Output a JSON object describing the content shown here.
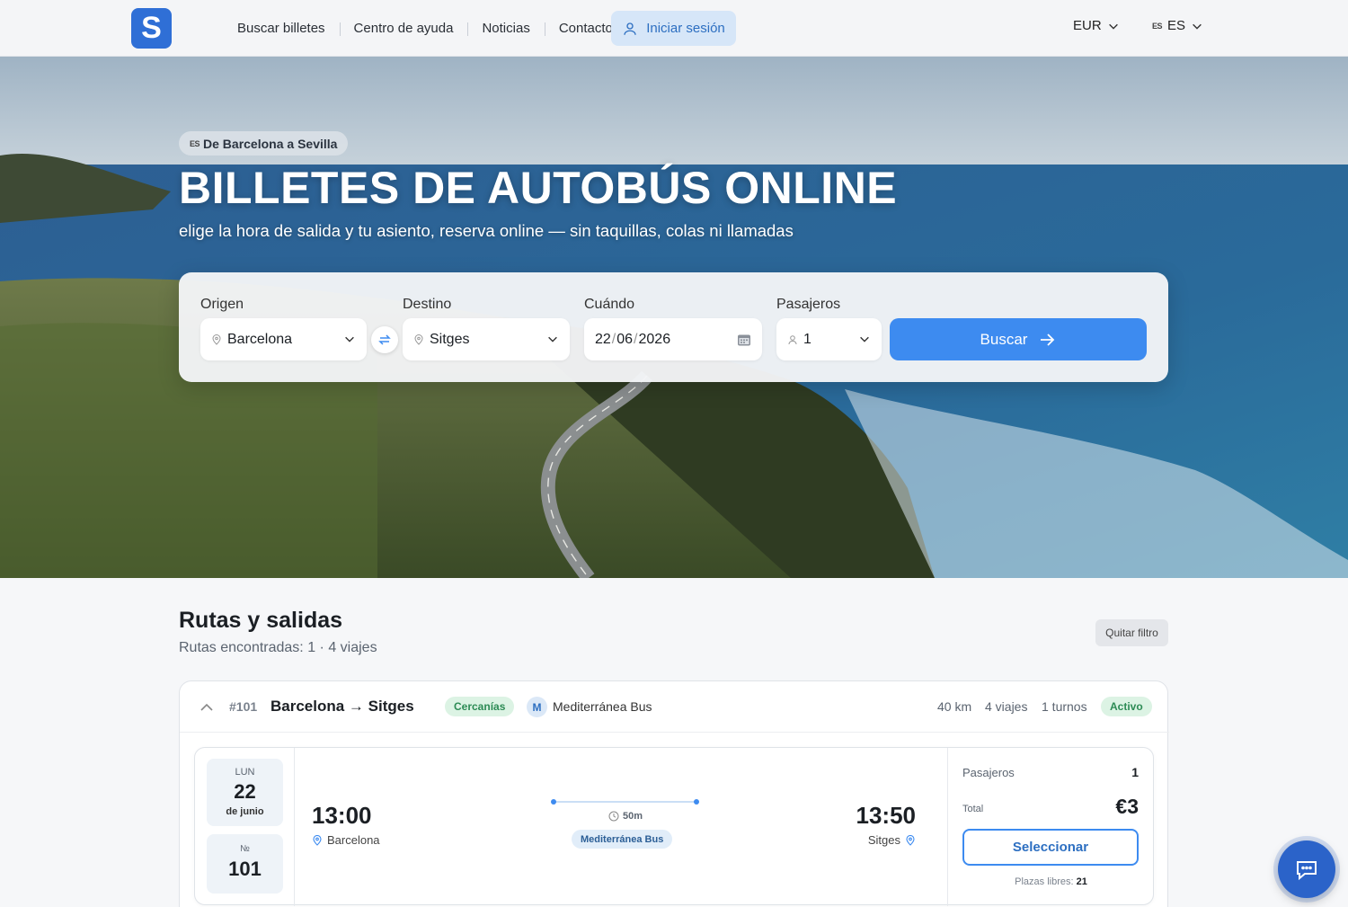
{
  "header": {
    "logo_letter": "S",
    "nav": [
      "Buscar billetes",
      "Centro de ayuda",
      "Noticias",
      "Contacto"
    ],
    "login_label": "Iniciar sesión",
    "currency": "EUR",
    "language_flag": "ES",
    "language": "ES"
  },
  "hero": {
    "badge_flag": "ES",
    "badge_label": "De Barcelona a Sevilla",
    "title": "BILLETES DE AUTOBÚS ONLINE",
    "subtitle": "elige la hora de salida y tu asiento, reserva online — sin taquillas, colas ni llamadas"
  },
  "search": {
    "origin_label": "Origen",
    "origin_value": "Barcelona",
    "dest_label": "Destino",
    "dest_value": "Sitges",
    "date_label": "Cuándo",
    "date_day": "22",
    "date_month": "06",
    "date_year": "2026",
    "date_sep": "/",
    "passengers_label": "Pasajeros",
    "passengers_value": "1",
    "search_button": "Buscar"
  },
  "routes": {
    "title": "Rutas y salidas",
    "subtitle": "Rutas encontradas: 1 · 4 viajes",
    "clear_filter": "Quitar filtro",
    "items": [
      {
        "number": "#101",
        "name": "Barcelona → Sitges",
        "type": "Cercanías",
        "operator_initial": "M",
        "operator": "Mediterránea Bus",
        "distance": "40 km",
        "trips": "4 viajes",
        "shifts": "1 turnos",
        "status": "Activo",
        "trip": {
          "dow": "LUN",
          "day": "22",
          "month": "de junio",
          "number_label": "№",
          "number": "101",
          "departure_time": "13:00",
          "departure_city": "Barcelona",
          "duration": "50m",
          "operator": "Mediterránea Bus",
          "arrival_time": "13:50",
          "arrival_city": "Sitges",
          "passengers_label": "Pasajeros",
          "passengers_value": "1",
          "total_label": "Total",
          "total_value": "€3",
          "select_button": "Seleccionar",
          "seats_label": "Plazas libres:",
          "seats_value": "21"
        }
      }
    ]
  },
  "colors": {
    "primary": "#3d8bf0",
    "logo": "#2f6fd6",
    "status_green": "#2d8b55",
    "chat": "#2b63c9"
  },
  "icons": {
    "login": "user-icon",
    "chevron": "chevron-down-icon",
    "swap": "swap-icon",
    "pin": "location-pin-icon",
    "calendar": "calendar-icon",
    "person": "person-icon",
    "arrow": "arrow-right-icon",
    "clock": "clock-icon",
    "chat": "chat-icon"
  }
}
